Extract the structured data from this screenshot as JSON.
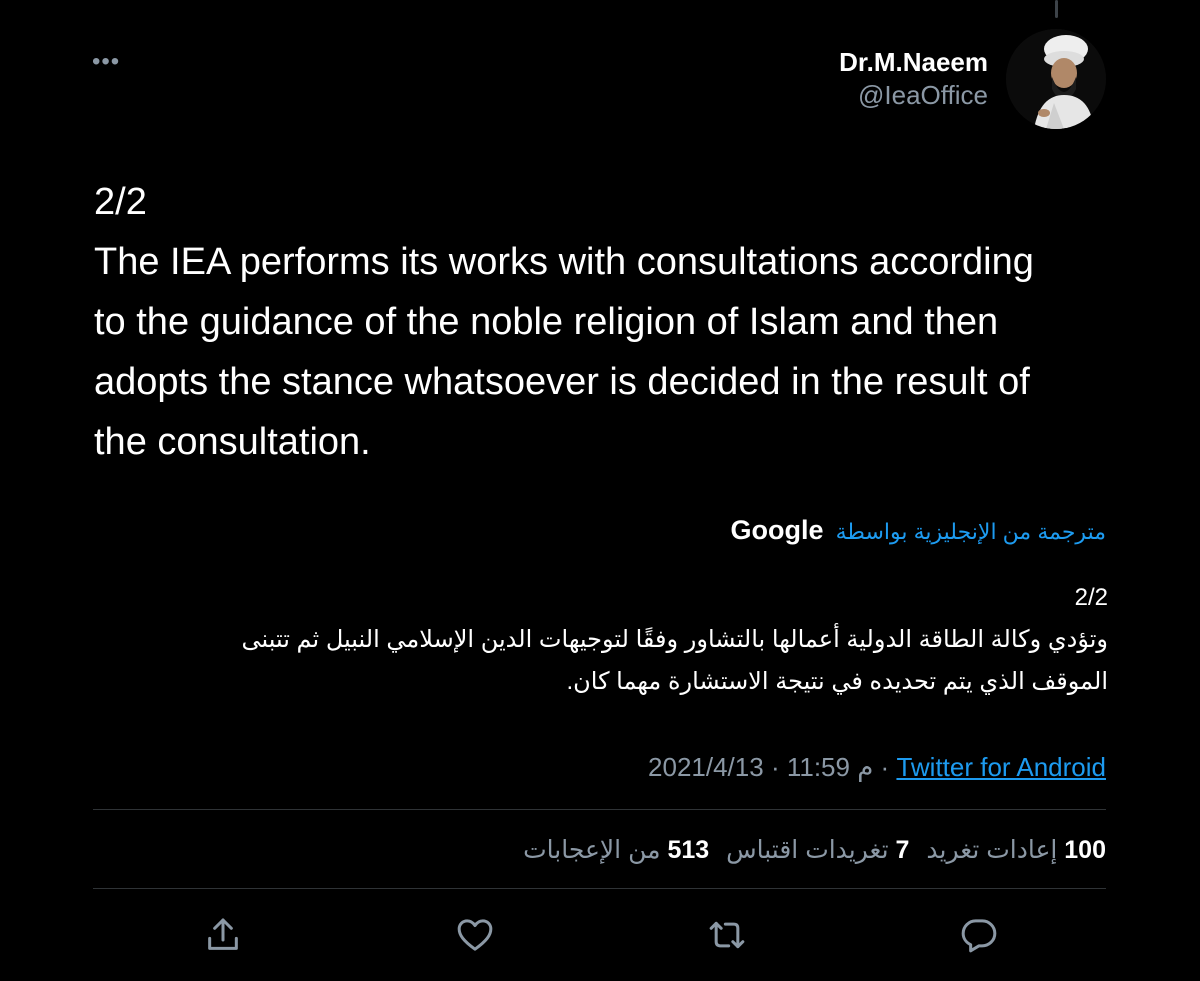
{
  "author": {
    "display_name": "Dr.M.Naeem",
    "handle": "@IeaOffice"
  },
  "tweet": {
    "text": "2/2\nThe IEA performs its works with consultations according\nto the guidance of the noble religion of Islam and then\nadopts the stance whatsoever is decided in the result of\nthe consultation."
  },
  "translation": {
    "label": "مترجمة من الإنجليزية بواسطة",
    "provider": "Google",
    "text": "2/2\nوتؤدي وكالة الطاقة الدولية أعمالها بالتشاور وفقًا لتوجيهات الدين الإسلامي النبيل ثم تتبنى\nالموقف الذي يتم تحديده في نتيجة الاستشارة مهما كان."
  },
  "meta": {
    "date": "2021/4/13",
    "separator": "·",
    "time": "11:59 م",
    "source": "Twitter for Android"
  },
  "stats": {
    "retweets_count": "100",
    "retweets_label": "إعادات تغريد",
    "quotes_count": "7",
    "quotes_label": "تغريدات اقتباس",
    "likes_count": "513",
    "likes_label": "من الإعجابات"
  },
  "more_icon": "•••",
  "icons": {
    "more": "more-horizontal-icon",
    "share": "share-icon",
    "like": "heart-icon",
    "retweet": "retweet-icon",
    "reply": "reply-icon"
  },
  "colors": {
    "background": "#000000",
    "text_primary": "#ffffff",
    "text_secondary": "#8b98a5",
    "accent": "#1d9bf0",
    "divider": "#2f3336"
  }
}
